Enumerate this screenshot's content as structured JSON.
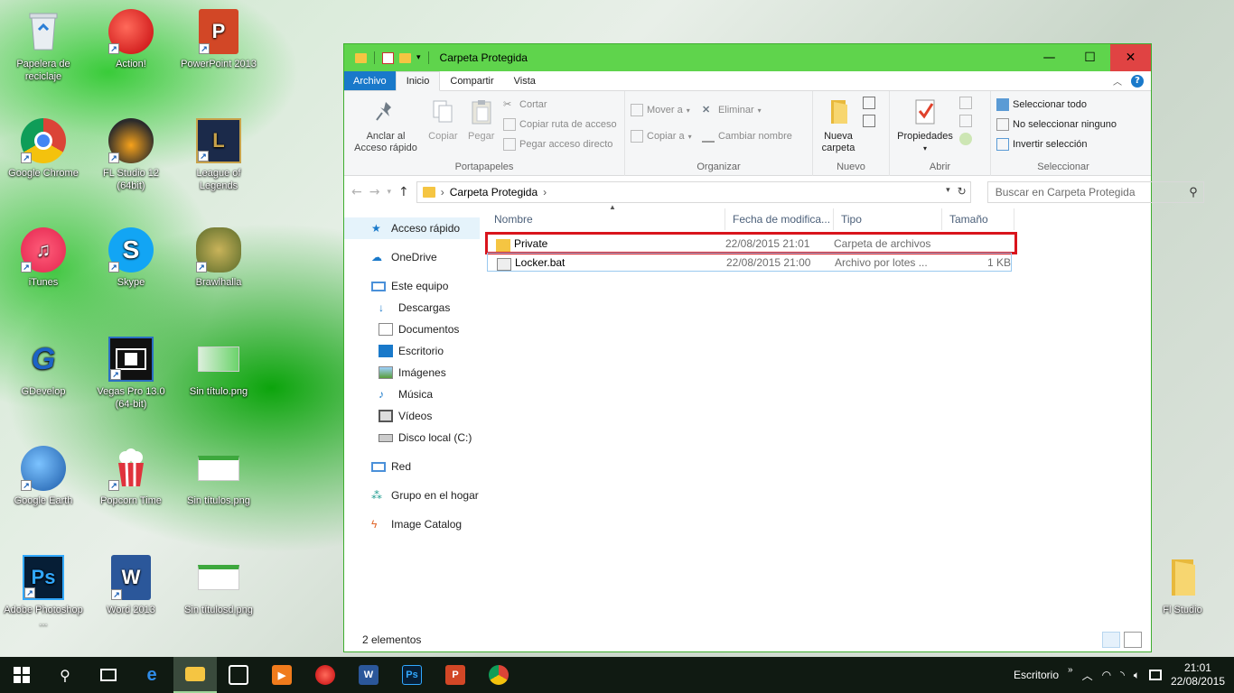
{
  "desktop": {
    "icons": [
      {
        "label": "Papelera de reciclaje",
        "icon": "recycle-bin-icon",
        "shortcut": false
      },
      {
        "label": "Action!",
        "icon": "action-icon",
        "shortcut": true
      },
      {
        "label": "PowerPoint 2013",
        "icon": "powerpoint-icon",
        "shortcut": true
      },
      {
        "label": "Google Chrome",
        "icon": "chrome-icon",
        "shortcut": true
      },
      {
        "label": "FL Studio 12 (64bit)",
        "icon": "fl-studio-icon",
        "shortcut": true
      },
      {
        "label": "League of Legends",
        "icon": "league-of-legends-icon",
        "shortcut": true
      },
      {
        "label": "iTunes",
        "icon": "itunes-icon",
        "shortcut": true
      },
      {
        "label": "Skype",
        "icon": "skype-icon",
        "shortcut": true
      },
      {
        "label": "Brawlhalla",
        "icon": "brawlhalla-icon",
        "shortcut": true
      },
      {
        "label": "GDevelop",
        "icon": "gdevelop-icon",
        "shortcut": false
      },
      {
        "label": "Vegas Pro 13.0 (64-bit)",
        "icon": "vegas-pro-icon",
        "shortcut": true
      },
      {
        "label": "Sin título.png",
        "icon": "image-file-icon",
        "shortcut": false
      },
      {
        "label": "Google Earth",
        "icon": "google-earth-icon",
        "shortcut": true
      },
      {
        "label": "Popcorn Time",
        "icon": "popcorn-time-icon",
        "shortcut": true
      },
      {
        "label": "Sin títulos.png",
        "icon": "image-file-icon",
        "shortcut": false
      },
      {
        "label": "Adobe Photoshop ...",
        "icon": "photoshop-icon",
        "shortcut": true
      },
      {
        "label": "Word 2013",
        "icon": "word-icon",
        "shortcut": true
      },
      {
        "label": "Sin títulosd.png",
        "icon": "image-file-icon",
        "shortcut": false
      },
      {
        "label": "Fl Studio",
        "icon": "folder-icon",
        "shortcut": false
      }
    ]
  },
  "window": {
    "title": "Carpeta Protegida",
    "controls": {
      "minimize": "—",
      "maximize": "☐",
      "close": "✕"
    }
  },
  "ribbon": {
    "tabs": [
      "Archivo",
      "Inicio",
      "Compartir",
      "Vista"
    ],
    "clipboard": {
      "pin_label": "Anclar al Acceso rápido",
      "copy_label": "Copiar",
      "paste_label": "Pegar",
      "cut_label": "Cortar",
      "copy_path_label": "Copiar ruta de acceso",
      "paste_shortcut_label": "Pegar acceso directo",
      "group_label": "Portapapeles"
    },
    "organize": {
      "move_label": "Mover a",
      "copy_to_label": "Copiar a",
      "delete_label": "Eliminar",
      "rename_label": "Cambiar nombre",
      "group_label": "Organizar"
    },
    "new": {
      "new_folder_label": "Nueva carpeta",
      "group_label": "Nuevo"
    },
    "open": {
      "properties_label": "Propiedades",
      "group_label": "Abrir"
    },
    "select": {
      "select_all_label": "Seleccionar todo",
      "select_none_label": "No seleccionar ninguno",
      "invert_label": "Invertir selección",
      "group_label": "Seleccionar"
    }
  },
  "address": {
    "path": "Carpeta Protegida",
    "search_placeholder": "Buscar en Carpeta Protegida"
  },
  "navpane": {
    "items": [
      {
        "label": "Acceso rápido",
        "icon": "star-icon"
      },
      {
        "label": "OneDrive",
        "icon": "cloud-icon"
      },
      {
        "label": "Este equipo",
        "icon": "computer-icon"
      },
      {
        "label": "Descargas",
        "icon": "download-icon"
      },
      {
        "label": "Documentos",
        "icon": "documents-icon"
      },
      {
        "label": "Escritorio",
        "icon": "desktop-icon"
      },
      {
        "label": "Imágenes",
        "icon": "pictures-icon"
      },
      {
        "label": "Música",
        "icon": "music-icon"
      },
      {
        "label": "Vídeos",
        "icon": "videos-icon"
      },
      {
        "label": "Disco local (C:)",
        "icon": "drive-icon"
      },
      {
        "label": "Red",
        "icon": "network-icon"
      },
      {
        "label": "Grupo en el hogar",
        "icon": "homegroup-icon"
      },
      {
        "label": "Image Catalog",
        "icon": "image-catalog-icon"
      }
    ]
  },
  "files": {
    "columns": [
      "Nombre",
      "Fecha de modifica...",
      "Tipo",
      "Tamaño"
    ],
    "rows": [
      {
        "name": "Private",
        "date": "22/08/2015 21:01",
        "type": "Carpeta de archivos",
        "size": ""
      },
      {
        "name": "Locker.bat",
        "date": "22/08/2015 21:00",
        "type": "Archivo por lotes ...",
        "size": "1 KB"
      }
    ]
  },
  "status": {
    "count": "2 elementos"
  },
  "taskbar": {
    "tray_label": "Escritorio",
    "time": "21:01",
    "date": "22/08/2015"
  },
  "colors": {
    "title_bar": "#5fd44c",
    "file_tab": "#1979ca",
    "highlight": "#d9141c",
    "taskbar": "#101a12"
  }
}
